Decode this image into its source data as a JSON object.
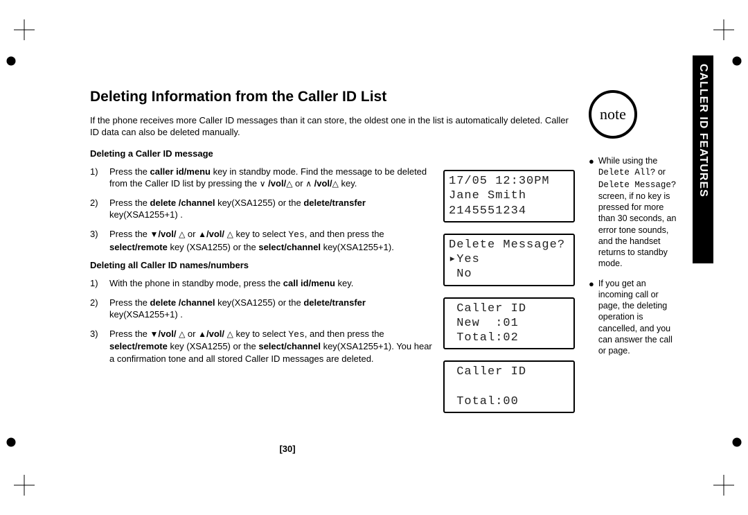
{
  "header": {
    "title": "Deleting Information from the Caller ID List",
    "section_tab": "CALLER ID FEATURES",
    "page_number": "[30]"
  },
  "intro": "If the phone receives more Caller ID messages than it can store, the oldest one in the list is automatically deleted. Caller ID data can also be deleted manually.",
  "section_a": {
    "heading": "Deleting a Caller ID message",
    "steps": [
      {
        "n": "1)",
        "html": "Press the <b>caller id/menu</b> key in standby mode. Find the message to be deleted from the Caller ID list by pressing the <span class='icon'>∨</span> <b>/vol/</b><span class='icon'>△</span> or <span class='icon'>∧</span> <b>/vol/</b><span class='icon'>△</span> key."
      },
      {
        "n": "2)",
        "html": "Press the <b>delete /channel</b> key(XSA1255) or the <b>delete/transfer</b> key(XSA1255+1) ."
      },
      {
        "n": "3)",
        "html": "Press the <span class='icon'>▼</span><b>/vol/</b> <span class='icon'>△</span> or <span class='icon'>▲</span><b>/vol/</b> <span class='icon'>△</span> key to select <span class='lcdfont'>Yes</span>, and then press the <b>select/remote</b> key (XSA1255) or the <b>select/channel</b> key(XSA1255+1)."
      }
    ]
  },
  "section_b": {
    "heading": "Deleting all Caller ID names/numbers",
    "steps": [
      {
        "n": "1)",
        "html": "With the phone in standby mode, press the <b>call id/menu</b> key."
      },
      {
        "n": "2)",
        "html": "Press the <b>delete /channel</b> key(XSA1255) or the <b>delete/transfer</b> key(XSA1255+1) ."
      },
      {
        "n": "3)",
        "html": "Press the <span class='icon'>▼</span><b>/vol/</b> <span class='icon'>△</span> or <span class='icon'>▲</span><b>/vol/</b> <span class='icon'>△</span> key to select <span class='lcdfont'>Yes</span>, and then press the <b>select/remote</b> key (XSA1255) or the <b>select/channel</b> key(XSA1255+1). You hear a confirmation tone and all stored Caller ID messages are deleted."
      }
    ]
  },
  "screens": [
    "17/05 12:30PM\nJane Smith\n2145551234",
    "Delete Message?\n▸Yes\n No",
    " Caller ID\n New  :01\n Total:02",
    " Caller ID\n\n Total:00"
  ],
  "note": {
    "badge": "note",
    "items": [
      {
        "html": "While using the <span class='lcdfont'>Delete All?</span> or <span class='lcdfont'>Delete Message?</span> screen, if no key is pressed for more than 30 seconds, an error tone sounds, and the handset returns to standby mode."
      },
      {
        "html": "If you get an incoming call or page, the deleting operation is cancelled, and you can answer the call or page."
      }
    ]
  }
}
